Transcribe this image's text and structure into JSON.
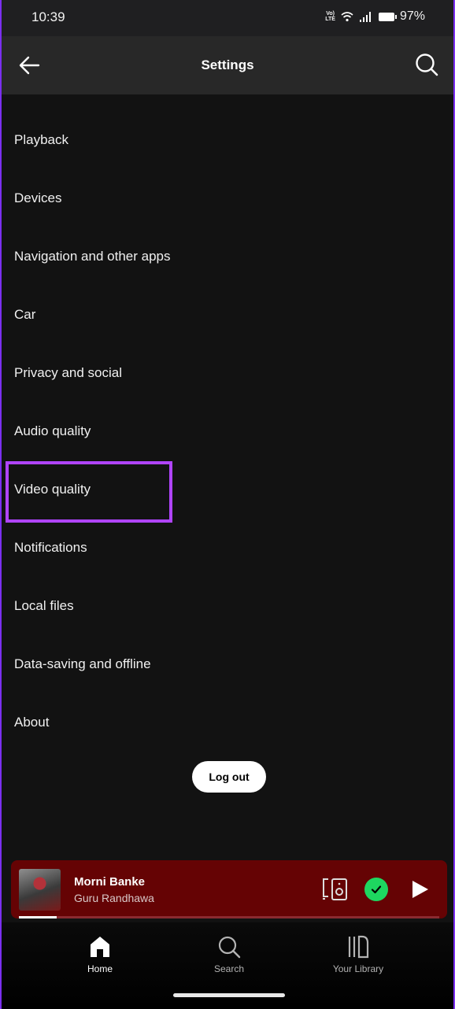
{
  "status_bar": {
    "time": "10:39",
    "volte_top": "Vo)",
    "volte_bottom": "LTE",
    "battery_percent": "97%",
    "icons": [
      "volte-icon",
      "wifi-icon",
      "signal-icon",
      "battery-icon"
    ]
  },
  "header": {
    "title": "Settings",
    "back_icon": "arrow-left-icon",
    "search_icon": "search-icon"
  },
  "settings": {
    "items": [
      {
        "label": "Playback"
      },
      {
        "label": "Devices"
      },
      {
        "label": "Navigation and other apps"
      },
      {
        "label": "Car"
      },
      {
        "label": "Privacy and social"
      },
      {
        "label": "Audio quality"
      },
      {
        "label": "Video quality",
        "highlighted": true
      },
      {
        "label": "Notifications"
      },
      {
        "label": "Local files"
      },
      {
        "label": "Data-saving and offline"
      },
      {
        "label": "About"
      }
    ],
    "highlight_color": "#b044ff"
  },
  "logout": {
    "label": "Log out"
  },
  "mini_player": {
    "title": "Morni Banke",
    "artist": "Guru Randhawa",
    "progress": 0.09,
    "background": "#650304",
    "saved_color": "#1ed760"
  },
  "bottom_nav": {
    "items": [
      {
        "label": "Home",
        "icon": "home-icon",
        "active": true
      },
      {
        "label": "Search",
        "icon": "search-icon",
        "active": false
      },
      {
        "label": "Your Library",
        "icon": "library-icon",
        "active": false
      }
    ]
  }
}
